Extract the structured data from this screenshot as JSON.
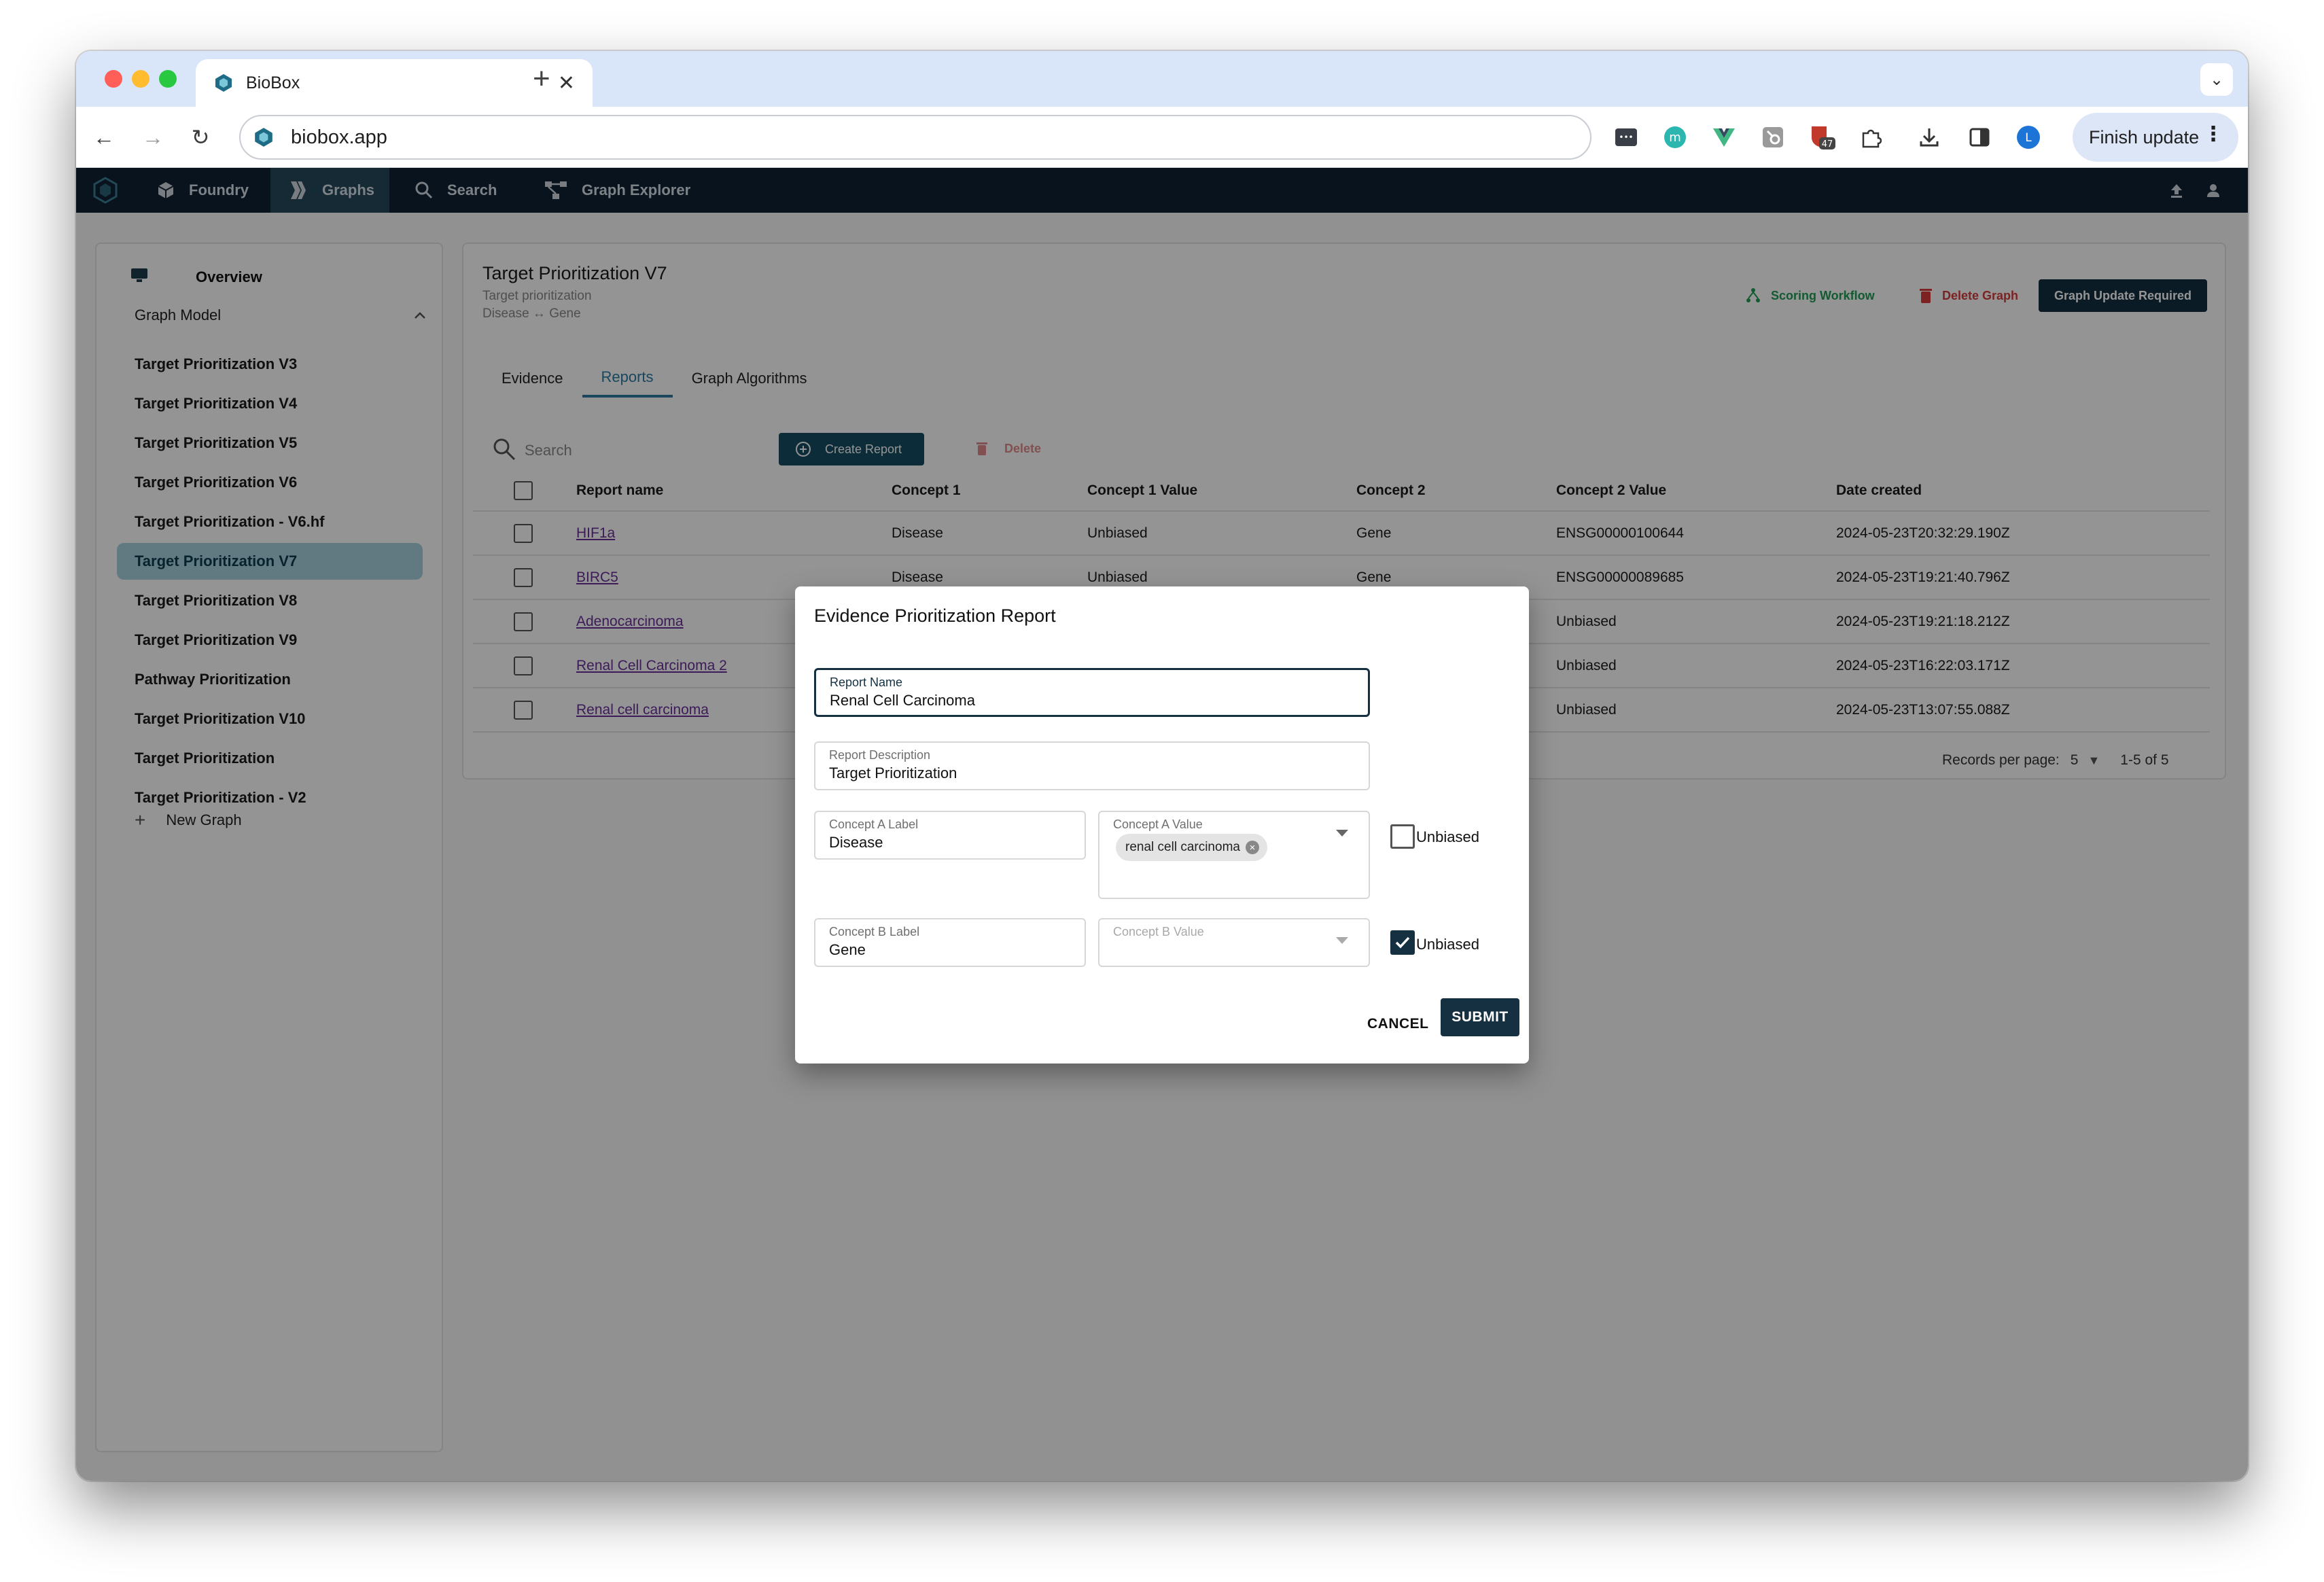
{
  "browser": {
    "tab_title": "BioBox",
    "url": "biobox.app",
    "finish_update_label": "Finish update",
    "extension_badge": "47",
    "profile_initial": "L"
  },
  "appbar": {
    "nav": [
      {
        "label": "Foundry",
        "icon": "cube-icon"
      },
      {
        "label": "Graphs",
        "icon": "graphs-icon",
        "active": true
      },
      {
        "label": "Search",
        "icon": "search-icon"
      },
      {
        "label": "Graph Explorer",
        "icon": "graph-explorer-icon"
      }
    ]
  },
  "sidebar": {
    "overview": "Overview",
    "section": "Graph Model",
    "items": [
      "Target Prioritization V3",
      "Target Prioritization V4",
      "Target Prioritization V5",
      "Target Prioritization V6",
      "Target Prioritization - V6.hf",
      "Target Prioritization V7",
      "Target Prioritization V8",
      "Target Prioritization V9",
      "Pathway Prioritization",
      "Target Prioritization V10",
      "Target Prioritization",
      "Target Prioritization - V2"
    ],
    "active_index": 5,
    "new_graph": "New Graph"
  },
  "main": {
    "title": "Target Prioritization V7",
    "subtitle": "Target prioritization",
    "relation": "Disease ↔ Gene",
    "scoring_workflow": "Scoring Workflow",
    "delete_graph": "Delete Graph",
    "update_required": "Graph Update Required",
    "tabs": [
      "Evidence",
      "Reports",
      "Graph Algorithms"
    ],
    "active_tab": 1,
    "search_placeholder": "Search",
    "create_report": "Create Report",
    "delete": "Delete",
    "columns": [
      "Report name",
      "Concept 1",
      "Concept 1 Value",
      "Concept 2",
      "Concept 2 Value",
      "Date created"
    ],
    "rows": [
      {
        "name": "HIF1a",
        "c1": "Disease",
        "c1v": "Unbiased",
        "c2": "Gene",
        "c2v": "ENSG00000100644",
        "date": "2024-05-23T20:32:29.190Z"
      },
      {
        "name": "BIRC5",
        "c1": "Disease",
        "c1v": "Unbiased",
        "c2": "Gene",
        "c2v": "ENSG00000089685",
        "date": "2024-05-23T19:21:40.796Z"
      },
      {
        "name": "Adenocarcinoma",
        "c1": "",
        "c1v": "",
        "c2": "",
        "c2v": "Unbiased",
        "date": "2024-05-23T19:21:18.212Z"
      },
      {
        "name": "Renal Cell Carcinoma 2",
        "c1": "",
        "c1v": "",
        "c2": "",
        "c2v": "Unbiased",
        "date": "2024-05-23T16:22:03.171Z"
      },
      {
        "name": "Renal cell carcinoma",
        "c1": "",
        "c1v": "",
        "c2": "",
        "c2v": "Unbiased",
        "date": "2024-05-23T13:07:55.088Z"
      }
    ],
    "records_per_page_label": "Records per page:",
    "records_per_page": "5",
    "range": "1-5 of 5"
  },
  "dialog": {
    "title": "Evidence Prioritization Report",
    "report_name_label": "Report Name",
    "report_name": "Renal Cell Carcinoma",
    "report_desc_label": "Report Description",
    "report_desc": "Target Prioritization",
    "concept_a_label_label": "Concept A Label",
    "concept_a_label": "Disease",
    "concept_a_value_label": "Concept A Value",
    "concept_a_chip": "renal cell carcinoma",
    "concept_a_unbiased": false,
    "concept_b_label_label": "Concept B Label",
    "concept_b_label": "Gene",
    "concept_b_value_label": "Concept B Value",
    "concept_b_unbiased": true,
    "unbiased_label": "Unbiased",
    "cancel": "CANCEL",
    "submit": "SUBMIT"
  }
}
